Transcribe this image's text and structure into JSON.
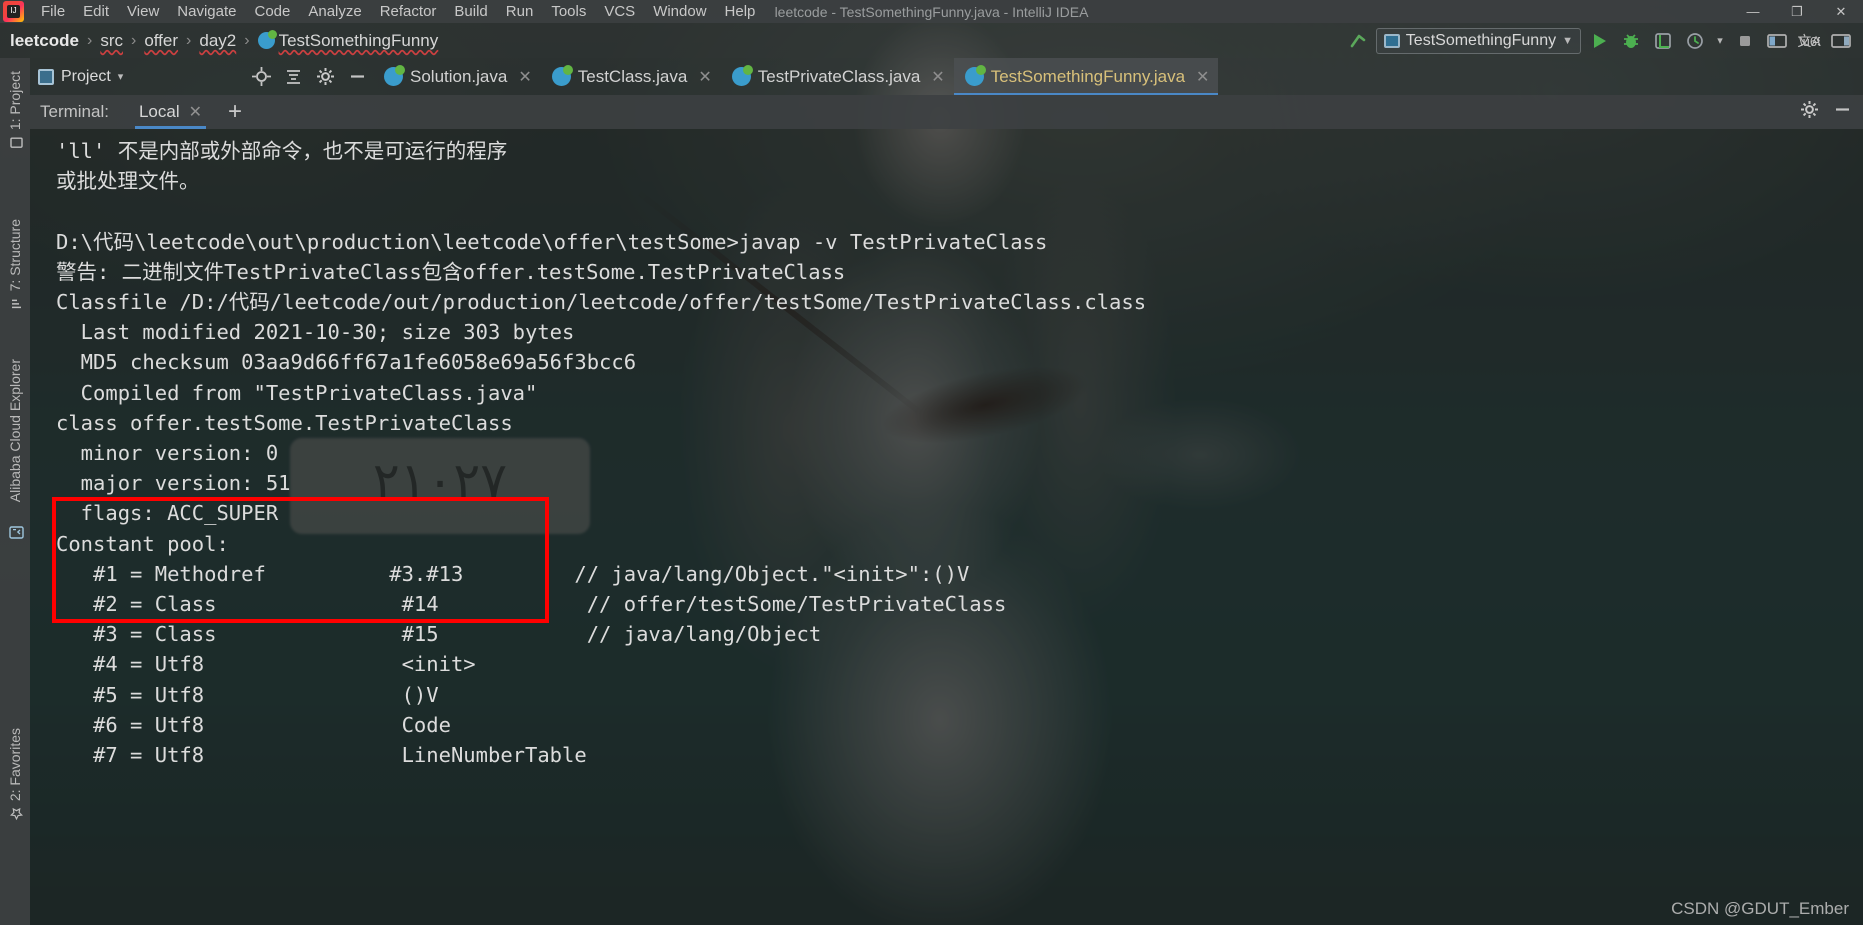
{
  "window": {
    "title": "leetcode - TestSomethingFunny.java - IntelliJ IDEA",
    "minimize": "—",
    "maximize": "❐",
    "close": "✕"
  },
  "menubar": {
    "items": [
      {
        "label": "File"
      },
      {
        "label": "Edit"
      },
      {
        "label": "View"
      },
      {
        "label": "Navigate"
      },
      {
        "label": "Code"
      },
      {
        "label": "Analyze"
      },
      {
        "label": "Refactor"
      },
      {
        "label": "Build"
      },
      {
        "label": "Run"
      },
      {
        "label": "Tools"
      },
      {
        "label": "VCS"
      },
      {
        "label": "Window"
      },
      {
        "label": "Help"
      }
    ]
  },
  "breadcrumb": {
    "items": [
      {
        "label": "leetcode",
        "bold": true
      },
      {
        "label": "src",
        "bold": false
      },
      {
        "label": "offer",
        "bold": false
      },
      {
        "label": "day2",
        "bold": false
      },
      {
        "label": "TestSomethingFunny",
        "bold": false,
        "icon": "java-class-icon"
      }
    ],
    "separator": "›"
  },
  "toolbar": {
    "up_arrow_icon": "up-arrow-icon",
    "run_config_name": "TestSomethingFunny",
    "run_config_caret": "▼",
    "run_icon": "run-icon",
    "debug_icon": "debug-icon",
    "coverage_icon": "coverage-icon",
    "profiler_icon": "profiler-icon",
    "profiler_caret": "▾",
    "stop_icon": "stop-icon",
    "layout_icon": "layout-icon",
    "translate_icon": "translate-icon",
    "search_everywhere_icon": "search-everywhere-icon"
  },
  "project_widget": {
    "label": "Project",
    "caret": "▾",
    "target_icon": "locate-target-icon",
    "collapse_icon": "collapse-all-icon",
    "settings_icon": "gear-icon",
    "hide_icon": "hide-panel-icon"
  },
  "editor_tabs": [
    {
      "name": "Solution.java",
      "active": false,
      "close": "✕"
    },
    {
      "name": "TestClass.java",
      "active": false,
      "close": "✕"
    },
    {
      "name": "TestPrivateClass.java",
      "active": false,
      "close": "✕"
    },
    {
      "name": "TestSomethingFunny.java",
      "active": true,
      "close": "✕"
    }
  ],
  "left_toolwindows": {
    "top": [
      {
        "label": "1: Project",
        "icon": "project-icon"
      },
      {
        "label": "7: Structure",
        "icon": "structure-icon"
      },
      {
        "label": "Alibaba Cloud Explorer",
        "icon": "cloud-icon"
      }
    ],
    "bottom": [
      {
        "label": "2: Favorites",
        "icon": "favorites-icon"
      }
    ]
  },
  "terminal": {
    "header_label": "Terminal:",
    "tab_name": "Local",
    "tab_close": "✕",
    "new_tab": "+",
    "settings_icon": "gear-icon",
    "hide_icon": "hide-panel-icon",
    "lines": [
      {
        "text": "'ll' 不是内部或外部命令，也不是可运行的程序",
        "indent": 0
      },
      {
        "text": "或批处理文件。",
        "indent": 0
      },
      {
        "text": "",
        "indent": 0
      },
      {
        "text": "D:\\代码\\leetcode\\out\\production\\leetcode\\offer\\testSome>javap -v TestPrivateClass",
        "indent": 0
      },
      {
        "text": "警告: 二进制文件TestPrivateClass包含offer.testSome.TestPrivateClass",
        "indent": 0
      },
      {
        "text": "Classfile /D:/代码/leetcode/out/production/leetcode/offer/testSome/TestPrivateClass.class",
        "indent": 0
      },
      {
        "text": "  Last modified 2021-10-30; size 303 bytes",
        "indent": 0
      },
      {
        "text": "  MD5 checksum 03aa9d66ff67a1fe6058e69a56f3bcc6",
        "indent": 0
      },
      {
        "text": "  Compiled from \"TestPrivateClass.java\"",
        "indent": 0
      },
      {
        "text": "class offer.testSome.TestPrivateClass",
        "indent": 0
      },
      {
        "text": "  minor version: 0",
        "indent": 0
      },
      {
        "text": "  major version: 51",
        "indent": 0
      },
      {
        "text": "  flags: ACC_SUPER",
        "indent": 0
      },
      {
        "text": "Constant pool:",
        "indent": 0
      },
      {
        "text": "   #1 = Methodref          #3.#13         // java/lang/Object.\"<init>\":()V",
        "indent": 0
      },
      {
        "text": "   #2 = Class               #14            // offer/testSome/TestPrivateClass",
        "indent": 0
      },
      {
        "text": "   #3 = Class               #15            // java/lang/Object",
        "indent": 0
      },
      {
        "text": "   #4 = Utf8                <init>",
        "indent": 0
      },
      {
        "text": "   #5 = Utf8                ()V",
        "indent": 0
      },
      {
        "text": "   #6 = Utf8                Code",
        "indent": 0
      },
      {
        "text": "   #7 = Utf8                LineNumberTable",
        "indent": 0
      }
    ]
  },
  "annotation": {
    "red_box_label": "highlighted-class-version-block"
  },
  "watermark": {
    "text": "CSDN @GDUT_Ember"
  },
  "wallpaper": {
    "license_plate_text": "٢١٠٢٧"
  },
  "colors": {
    "accent_blue": "#4a88c7",
    "annotation_red": "#ff0000",
    "active_tab_text": "#d8c07a",
    "terminal_text": "#dcdcdc",
    "chrome_bg": "#3c3f41"
  }
}
